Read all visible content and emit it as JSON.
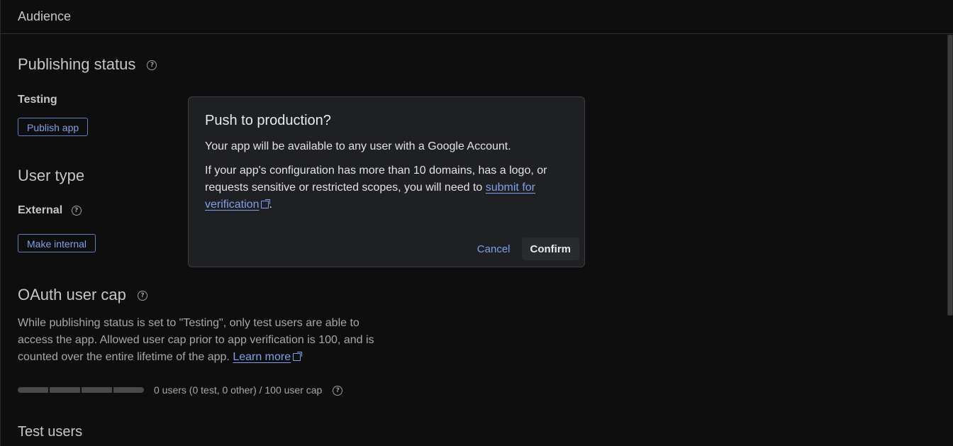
{
  "header": {
    "title": "Audience"
  },
  "publishing_status": {
    "title": "Publishing status",
    "status": "Testing",
    "publish_button": "Publish app"
  },
  "user_type": {
    "title": "User type",
    "value": "External",
    "make_internal_button": "Make internal"
  },
  "oauth_cap": {
    "title": "OAuth user cap",
    "description": "While publishing status is set to \"Testing\", only test users are able to access the app. Allowed user cap prior to app verification is 100, and is counted over the entire lifetime of the app.",
    "learn_more": "Learn more",
    "usage_text": "0 users (0 test, 0 other) / 100 user cap",
    "usage_fraction": 0.0
  },
  "test_users": {
    "title": "Test users"
  },
  "dialog": {
    "title": "Push to production?",
    "p1": "Your app will be available to any user with a Google Account.",
    "p2_prefix": "If your app's configuration has more than 10 domains, has a logo, or requests sensitive or restricted scopes, you will need to",
    "p2_link": "submit for verification",
    "p2_suffix": ".",
    "cancel": "Cancel",
    "confirm": "Confirm"
  },
  "icons": {
    "help": "help-circle-icon",
    "external_link": "external-link-icon"
  },
  "colors": {
    "background": "#0e0e0e",
    "dialog_background": "#1f2023",
    "accent": "#7fa0ea"
  }
}
